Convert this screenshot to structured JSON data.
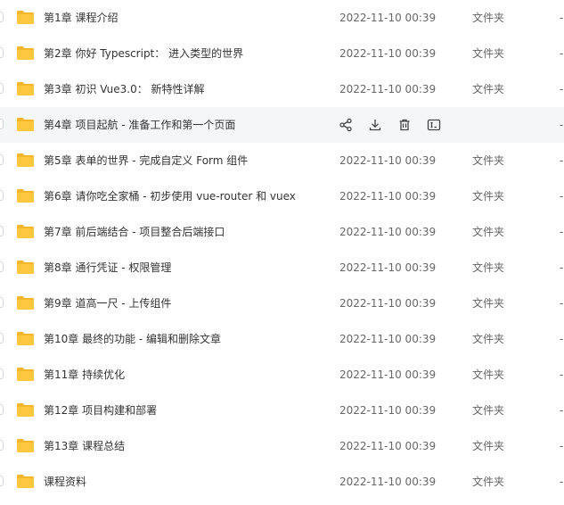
{
  "files": [
    {
      "name": "第1章 课程介绍",
      "date": "2022-11-10 00:39",
      "type": "文件夹",
      "size": "-"
    },
    {
      "name": "第2章 你好 Typescript： 进入类型的世界",
      "date": "2022-11-10 00:39",
      "type": "文件夹",
      "size": "-"
    },
    {
      "name": "第3章 初识 Vue3.0： 新特性详解",
      "date": "2022-11-10 00:39",
      "type": "文件夹",
      "size": "-"
    },
    {
      "name": "第4章 项目起航 - 准备工作和第一个页面",
      "date": "",
      "type": "",
      "size": "-"
    },
    {
      "name": "第5章 表单的世界 - 完成自定义 Form 组件",
      "date": "2022-11-10 00:39",
      "type": "文件夹",
      "size": "-"
    },
    {
      "name": "第6章 请你吃全家桶 - 初步使用 vue-router 和 vuex",
      "date": "2022-11-10 00:39",
      "type": "文件夹",
      "size": "-"
    },
    {
      "name": "第7章 前后端结合 - 项目整合后端接口",
      "date": "2022-11-10 00:39",
      "type": "文件夹",
      "size": "-"
    },
    {
      "name": "第8章 通行凭证 - 权限管理",
      "date": "2022-11-10 00:39",
      "type": "文件夹",
      "size": "-"
    },
    {
      "name": "第9章 道高一尺 - 上传组件",
      "date": "2022-11-10 00:39",
      "type": "文件夹",
      "size": "-"
    },
    {
      "name": "第10章 最终的功能 - 编辑和删除文章",
      "date": "2022-11-10 00:39",
      "type": "文件夹",
      "size": "-"
    },
    {
      "name": "第11章 持续优化",
      "date": "2022-11-10 00:39",
      "type": "文件夹",
      "size": "-"
    },
    {
      "name": "第12章 项目构建和部署",
      "date": "2022-11-10 00:39",
      "type": "文件夹",
      "size": "-"
    },
    {
      "name": "第13章 课程总结",
      "date": "2022-11-10 00:39",
      "type": "文件夹",
      "size": "-"
    },
    {
      "name": "课程资料",
      "date": "2022-11-10 00:39",
      "type": "文件夹",
      "size": "-"
    }
  ],
  "hovered_index": 3,
  "row_actions": [
    "share-icon",
    "download-icon",
    "delete-icon",
    "rename-icon"
  ],
  "colors": {
    "folder": "#FFC73D",
    "folder_tab": "#F7B52C",
    "hover_bg": "#f5f6f8",
    "action_icon": "#444444"
  }
}
